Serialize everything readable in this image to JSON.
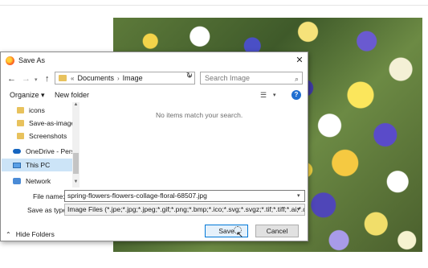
{
  "dialog": {
    "title": "Save As",
    "close_glyph": "✕"
  },
  "navbar": {
    "back_glyph": "←",
    "forward_glyph": "→",
    "dropdown_glyph": "▾",
    "up_glyph": "↑",
    "breadcrumb_chevron": "«",
    "breadcrumbs": [
      "Documents",
      "Image"
    ],
    "breadcrumb_separator": "›",
    "refresh_glyph": "↻",
    "search_placeholder": "Search Image",
    "search_glyph": "⌕"
  },
  "toolbar": {
    "organize_label": "Organize ▾",
    "new_folder_label": "New folder",
    "view_glyph": "☰",
    "help_glyph": "?"
  },
  "nav_pane": {
    "items": [
      {
        "label": "icons",
        "icon": "folder-icon"
      },
      {
        "label": "Save-as-image-t",
        "icon": "folder-icon"
      },
      {
        "label": "Screenshots",
        "icon": "folder-icon"
      },
      {
        "label": "OneDrive - Persor",
        "icon": "cloud-icon"
      },
      {
        "label": "This PC",
        "icon": "computer-icon",
        "selected": true
      },
      {
        "label": "Network",
        "icon": "network-icon"
      }
    ]
  },
  "content": {
    "empty_message": "No items match your search."
  },
  "form": {
    "file_name_label": "File name:",
    "file_name_value": "spring-flowers-flowers-collage-floral-68507.jpg",
    "save_as_type_label": "Save as type:",
    "save_as_type_value": "Image Files (*.jpe;*.jpg;*.jpeg;*.gif;*.png;*.bmp;*.ico;*.svg;*.svgz;*.tif;*.tiff;*.ai;*.drw;*.pc"
  },
  "footer": {
    "hide_folders_label": "Hide Folders",
    "save_label": "Save",
    "cancel_label": "Cancel"
  },
  "colors": {
    "accent": "#0078d7",
    "selection": "#cce4f7",
    "folder": "#e8c25d"
  }
}
